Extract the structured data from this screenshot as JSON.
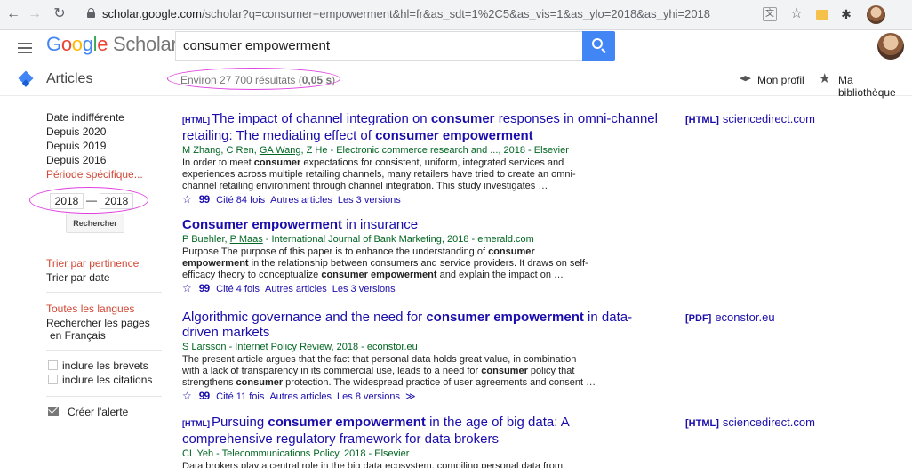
{
  "browser": {
    "url_host": "scholar.google.com",
    "url_path": "/scholar?q=consumer+empowerment&hl=fr&as_sdt=1%2C5&as_vis=1&as_ylo=2018&as_yhi=2018",
    "back_icon": "←",
    "forward_icon": "→",
    "reload_icon": "↻",
    "translate_icon": "文",
    "star_icon": "☆",
    "puzzle_icon": "✱"
  },
  "header": {
    "logo_g": "G",
    "logo_o1": "o",
    "logo_o2": "o",
    "logo_g2": "g",
    "logo_l": "l",
    "logo_e": "e",
    "logo_scholar": " Scholar",
    "search_value": "consumer empowerment"
  },
  "subheader": {
    "articles": "Articles",
    "results_prefix": "Environ 27 700 résultats (",
    "results_time": "0,05 s",
    "results_suffix": ")",
    "my_profile": "Mon profil",
    "my_library": "Ma bibliothèque",
    "library_icon": "★"
  },
  "sidebar": {
    "dates": [
      "Date indifférente",
      "Depuis 2020",
      "Depuis 2019",
      "Depuis 2016"
    ],
    "custom_period": "Période spécifique...",
    "year_from": "2018",
    "year_to": "2018",
    "year_dash": "—",
    "search_button": "Rechercher",
    "sort_relevance": "Trier par pertinence",
    "sort_date": "Trier par date",
    "all_languages": "Toutes les langues",
    "french_pages_1": "Rechercher les pages",
    "french_pages_2": "en Français",
    "include_patents": "inclure les brevets",
    "include_citations": "inclure les citations",
    "create_alert": "Créer l'alerte"
  },
  "results": [
    {
      "tag": "[HTML]",
      "title_parts": [
        "The impact of channel integration on ",
        "consumer",
        " responses in omni-channel",
        "retailing: The mediating effect of ",
        "consumer empowerment"
      ],
      "authors": [
        "M Zhang, C Ren, ",
        "GA Wang",
        ", Z He - Electronic commerce research and ..., 2018 - Elsevier"
      ],
      "snippet": [
        "In order to meet ",
        "consumer",
        " expectations for consistent, uniform, integrated services and",
        "experiences across multiple retailing channels, many retailers have tried to create an omni-",
        "channel retailing environment through channel integration. This study investigates …"
      ],
      "cited": "Cité 84 fois",
      "related": "Autres articles",
      "versions": "Les 3 versions",
      "side_tag": "[HTML]",
      "side_source": "sciencedirect.com"
    },
    {
      "title_parts": [
        "Consumer empowerment",
        " in insurance"
      ],
      "authors": [
        "P Buehler, ",
        "P Maas",
        " - International Journal of Bank Marketing, 2018 - emerald.com"
      ],
      "snippet": [
        "Purpose The purpose of this paper is to enhance the understanding of ",
        "consumer",
        "empowerment",
        " in the relationship between consumers and service providers. It draws on self-",
        "efficacy theory to conceptualize ",
        "consumer empowerment",
        " and explain the impact on …"
      ],
      "cited": "Cité 4 fois",
      "related": "Autres articles",
      "versions": "Les 3 versions"
    },
    {
      "title_parts": [
        "Algorithmic governance and the need for ",
        "consumer empowerment",
        " in data-",
        "driven markets"
      ],
      "authors": [
        "S Larsson",
        " - Internet Policy Review, 2018 - econstor.eu"
      ],
      "snippet": [
        "The present article argues that the fact that personal data holds great value, in combination",
        "with a lack of transparency in its commercial use, leads to a need for ",
        "consumer",
        " policy that",
        "strengthens ",
        "consumer",
        " protection. The widespread practice of user agreements and consent …"
      ],
      "cited": "Cité 11 fois",
      "related": "Autres articles",
      "versions": "Les 8 versions",
      "more_icon": "≫",
      "side_tag": "[PDF]",
      "side_source": "econstor.eu"
    },
    {
      "tag": "[HTML]",
      "title_parts": [
        "Pursuing ",
        "consumer empowerment",
        " in the age of big data: A",
        "comprehensive regulatory framework for data brokers"
      ],
      "authors": [
        "CL Yeh - Telecommunications Policy, 2018 - Elsevier"
      ],
      "snippet": [
        "Data brokers play a central role in the big data ecosystem, compiling personal data from"
      ],
      "side_tag": "[HTML]",
      "side_source": "sciencedirect.com"
    }
  ],
  "glyphs": {
    "star": "☆",
    "cite": "99"
  },
  "colors": {
    "link": "#1a0dab",
    "authors": "#006621",
    "accent_red": "#d14836",
    "search_blue": "#4285f4",
    "annotation": "#e040e0"
  }
}
